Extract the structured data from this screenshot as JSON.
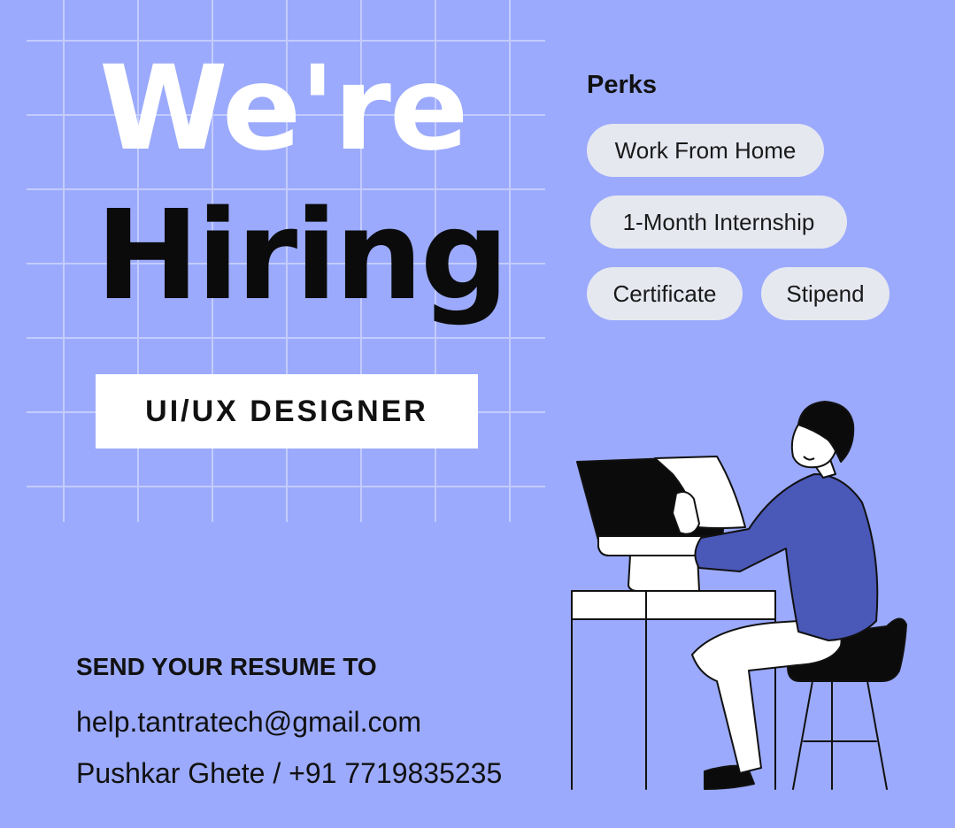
{
  "headline": {
    "line1": "We're",
    "line2": "Hiring"
  },
  "role": "UI/UX DESIGNER",
  "perks": {
    "title": "Perks",
    "items": [
      "Work From Home",
      "1-Month Internship",
      "Certificate",
      "Stipend"
    ]
  },
  "contact": {
    "title": "SEND YOUR RESUME TO",
    "email": "help.tantratech@gmail.com",
    "person": "Pushkar Ghete / +91 7719835235"
  },
  "colors": {
    "background": "#9baafc",
    "pill": "#e6e8f0",
    "shirt": "#4a58b8",
    "dark": "#0b0b0b",
    "white": "#ffffff"
  },
  "icons": [
    "person-at-computer-illustration"
  ]
}
